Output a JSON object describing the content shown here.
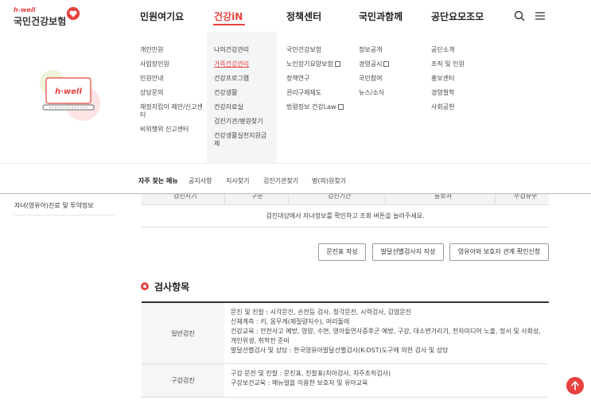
{
  "logo": {
    "small": "h-well",
    "main": "국민건강보험"
  },
  "gnb": [
    {
      "label": "민원여기요",
      "active": false
    },
    {
      "label": "건강iN",
      "active": true
    },
    {
      "label": "정책센터",
      "active": false
    },
    {
      "label": "국민과함께",
      "active": false
    },
    {
      "label": "공단요모조모",
      "active": false
    }
  ],
  "header_icons": [
    "search-icon",
    "menu-icon"
  ],
  "illustration": {
    "label": "h·well"
  },
  "mega_menu": {
    "col1": [
      "개인민원",
      "사업장민원",
      "민원안내",
      "상담문의",
      "재정지킴이 제안/신고센터",
      "비위행위 신고센터"
    ],
    "col2": [
      "나의건강관리",
      "가족건강관리",
      "건강프로그램",
      "건강생활",
      "건강자료실",
      "검진기관/병원찾기",
      "건강생활실천지원금제"
    ],
    "col3": [
      {
        "label": "국민건강보험",
        "external": false
      },
      {
        "label": "노인장기요양보험",
        "external": true
      },
      {
        "label": "정책연구",
        "external": false
      },
      {
        "label": "권리구제제도",
        "external": false
      },
      {
        "label": "법령정보 건강Law",
        "external": true
      }
    ],
    "col4": [
      {
        "label": "정보공개",
        "external": false
      },
      {
        "label": "경영공시",
        "external": true
      },
      {
        "label": "국민참여",
        "external": false
      },
      {
        "label": "뉴스/소식",
        "external": false
      }
    ],
    "col5": [
      "공단소개",
      "조직 및 인원",
      "홍보센터",
      "경영철학",
      "사회공헌"
    ]
  },
  "faq": {
    "title": "자주 찾는 메뉴",
    "links": [
      "공지사항",
      "지사찾기",
      "검진기관찾기",
      "병(의)원찾기"
    ]
  },
  "sidebar": {
    "item": "자녀(영유아)진료 및 투약정보"
  },
  "results_table": {
    "headers": [
      "검진시기",
      "구분",
      "검진기간",
      "통보처",
      "수검유무"
    ],
    "empty_message": "검진대상에서 자녀정보를 확인하고 조회 버튼을 눌러주세요."
  },
  "buttons": [
    "문진표 작성",
    "발달선별검사지 작성",
    "영유아와 보호자 관계 확인신청"
  ],
  "section": {
    "title": "검사항목"
  },
  "items_table": [
    {
      "label": "일반검진",
      "lines": [
        "문진 및 진찰 : 시각문진, 손전등 검사, 청각문진, 시력검사, 감염문진",
        "신체계측 : 키, 몸무게(체질량지수), 머리둘레",
        "건강교육 : 안전사고 예방, 영양, 수면, 영아돌연사증후군 예방, 구강, 대소변가리기, 전자미디어 노출, 정서 및 사회성, 개인위생, 취학전 준비",
        "발달선별검사 및 상담 : 한국영유아발달선별검사(K-DST)도구에 의한 검사 및 상담"
      ]
    },
    {
      "label": "구강검진",
      "lines": [
        "구강 문진 및 진찰 : 문진표, 진찰표(치아검사, 치주조직검사)",
        "구강보건교육 : 매뉴얼을 이용한 보호자 및 유아교육"
      ]
    }
  ],
  "colors": {
    "accent": "#e8423f"
  }
}
